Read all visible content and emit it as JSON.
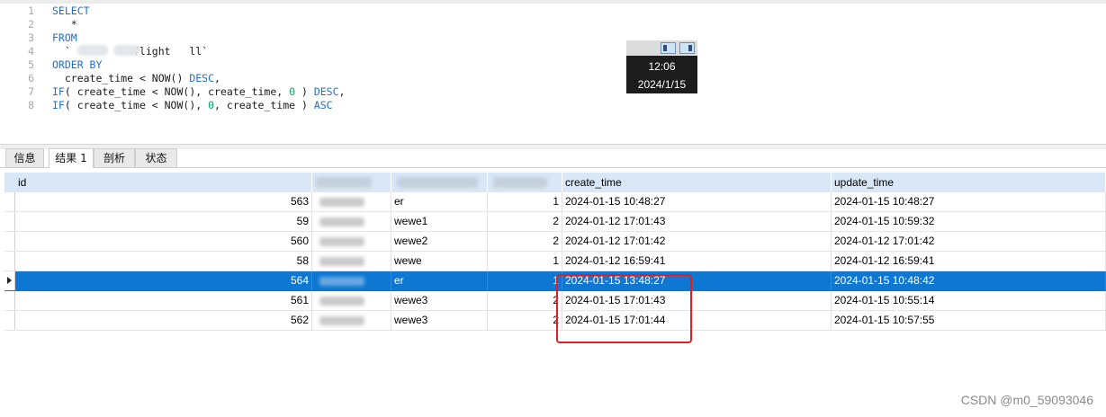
{
  "editor": {
    "lines": [
      {
        "n": "1",
        "parts": [
          {
            "t": "SELECT",
            "c": "kw"
          }
        ]
      },
      {
        "n": "2",
        "parts": [
          {
            "t": "   *",
            "c": "code"
          }
        ]
      },
      {
        "n": "3",
        "parts": [
          {
            "t": "FROM",
            "c": "kw"
          }
        ]
      },
      {
        "n": "4",
        "parts": [
          {
            "t": "  `          flight   ll`",
            "c": "code"
          }
        ]
      },
      {
        "n": "5",
        "parts": [
          {
            "t": "ORDER BY",
            "c": "kw"
          }
        ]
      },
      {
        "n": "6",
        "parts": [
          {
            "t": "  create_time < NOW() ",
            "c": "code"
          },
          {
            "t": "DESC",
            "c": "kw"
          },
          {
            "t": ",",
            "c": "code"
          }
        ]
      },
      {
        "n": "7",
        "parts": [
          {
            "t": "IF",
            "c": "kw"
          },
          {
            "t": "( create_time < NOW(), create_time, ",
            "c": "code"
          },
          {
            "t": "0",
            "c": "num"
          },
          {
            "t": " ) ",
            "c": "code"
          },
          {
            "t": "DESC",
            "c": "kw"
          },
          {
            "t": ",",
            "c": "code"
          }
        ]
      },
      {
        "n": "8",
        "parts": [
          {
            "t": "IF",
            "c": "kw"
          },
          {
            "t": "( create_time < NOW(), ",
            "c": "code"
          },
          {
            "t": "0",
            "c": "num"
          },
          {
            "t": ", create_time ) ",
            "c": "code"
          },
          {
            "t": "ASC",
            "c": "kw"
          }
        ]
      }
    ]
  },
  "clock": {
    "time": "12:06",
    "date": "2024/1/15"
  },
  "tabs": [
    {
      "label": "信息",
      "active": false
    },
    {
      "label": "结果 1",
      "active": true
    },
    {
      "label": "剖析",
      "active": false
    },
    {
      "label": "状态",
      "active": false
    }
  ],
  "grid": {
    "headers": {
      "id": "id",
      "create_time": "create_time",
      "update_time": "update_time"
    },
    "rows": [
      {
        "id": "563",
        "c3": "er",
        "c4": "1",
        "create_time": "2024-01-15 10:48:27",
        "update_time": "2024-01-15 10:48:27",
        "selected": false
      },
      {
        "id": "59",
        "c3": "wewe1",
        "c4": "2",
        "create_time": "2024-01-12 17:01:43",
        "update_time": "2024-01-15 10:59:32",
        "selected": false
      },
      {
        "id": "560",
        "c3": "wewe2",
        "c4": "2",
        "create_time": "2024-01-12 17:01:42",
        "update_time": "2024-01-12 17:01:42",
        "selected": false
      },
      {
        "id": "58",
        "c3": "wewe",
        "c4": "1",
        "create_time": "2024-01-12 16:59:41",
        "update_time": "2024-01-12 16:59:41",
        "selected": false
      },
      {
        "id": "564",
        "c3": "er",
        "c4": "1",
        "create_time": "2024-01-15 13:48:27",
        "update_time": "2024-01-15 10:48:42",
        "selected": true
      },
      {
        "id": "561",
        "c3": "wewe3",
        "c4": "2",
        "create_time": "2024-01-15 17:01:43",
        "update_time": "2024-01-15 10:55:14",
        "selected": false
      },
      {
        "id": "562",
        "c3": "wewe3",
        "c4": "2",
        "create_time": "2024-01-15 17:01:44",
        "update_time": "2024-01-15 10:57:55",
        "selected": false
      }
    ]
  },
  "watermark": "CSDN @m0_59093046",
  "colors": {
    "selection": "#0d77d1",
    "header": "#d9e7f7",
    "keyword": "#1f6fc8",
    "annotation": "#e02020"
  }
}
